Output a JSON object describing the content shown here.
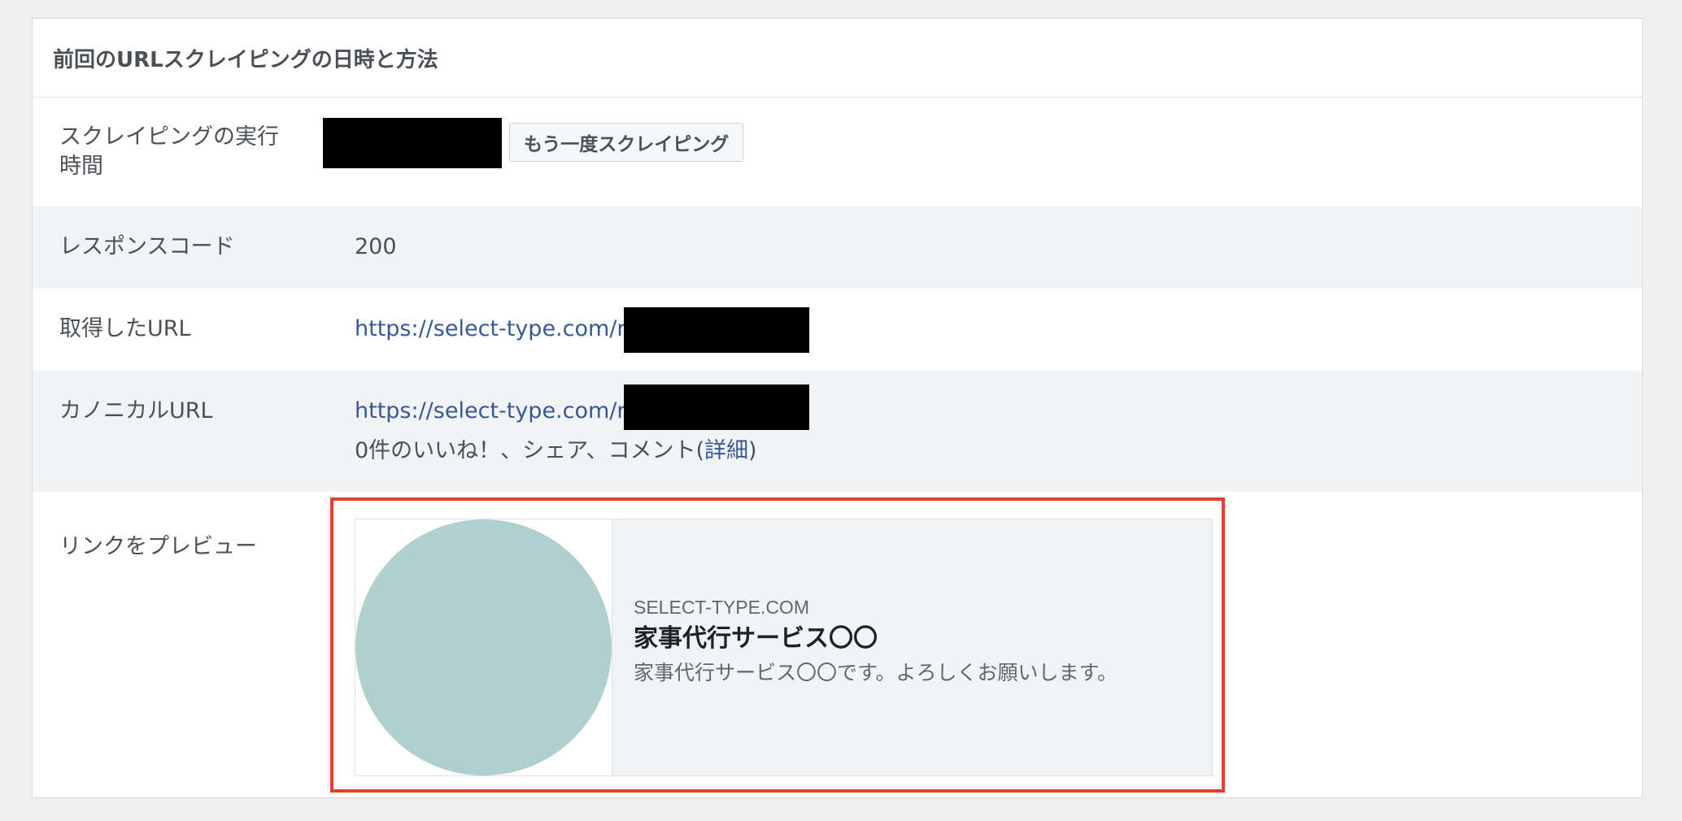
{
  "panel": {
    "title": "前回のURLスクレイピングの日時と方法"
  },
  "rows": {
    "scrape_time": {
      "label": "スクレイピングの実行時間",
      "button": "もう一度スクレイピング"
    },
    "response_code": {
      "label": "レスポンスコード",
      "value": "200"
    },
    "fetched_url": {
      "label": "取得したURL",
      "url": "https://select-type.com/rsv/"
    },
    "canonical_url": {
      "label": "カノニカルURL",
      "url": "https://select-type.com/rsv/",
      "engagement_prefix": "0件のいいね！、シェア、コメント(",
      "details_link": "詳細",
      "engagement_suffix": ")"
    },
    "link_preview": {
      "label": "リンクをプレビュー",
      "domain": "SELECT-TYPE.COM",
      "title": "家事代行サービス〇〇",
      "description": "家事代行サービス〇〇です。よろしくお願いします。"
    }
  },
  "colors": {
    "link": "#365899",
    "highlight_border": "#e0412b",
    "preview_image": "#b0cfcf"
  }
}
